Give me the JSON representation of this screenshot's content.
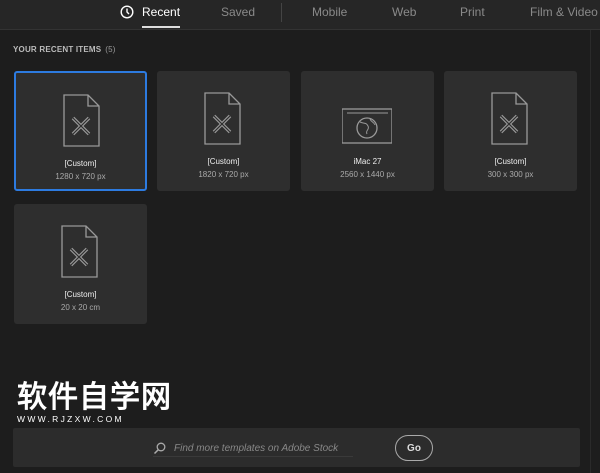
{
  "tabs": [
    {
      "label": "Recent",
      "active": true
    },
    {
      "label": "Saved"
    },
    {
      "label": "Mobile"
    },
    {
      "label": "Web"
    },
    {
      "label": "Print"
    },
    {
      "label": "Film & Video"
    }
  ],
  "section": {
    "title": "YOUR RECENT ITEMS",
    "count": "(5)"
  },
  "items": [
    {
      "title": "[Custom]",
      "size": "1280 x 720 px",
      "icon": "document-icon",
      "selected": true
    },
    {
      "title": "[Custom]",
      "size": "1820 x 720 px",
      "icon": "document-icon"
    },
    {
      "title": "iMac 27",
      "size": "2560 x 1440 px",
      "icon": "web-icon"
    },
    {
      "title": "[Custom]",
      "size": "300 x 300 px",
      "icon": "document-icon"
    },
    {
      "title": "[Custom]",
      "size": "20 x 20 cm",
      "icon": "document-icon"
    }
  ],
  "search": {
    "placeholder": "Find more templates on Adobe Stock",
    "go_label": "Go"
  },
  "watermark": {
    "cn": "软件自学网",
    "en": "WWW.RJZXW.COM"
  },
  "colors": {
    "accent": "#2d7be0"
  }
}
